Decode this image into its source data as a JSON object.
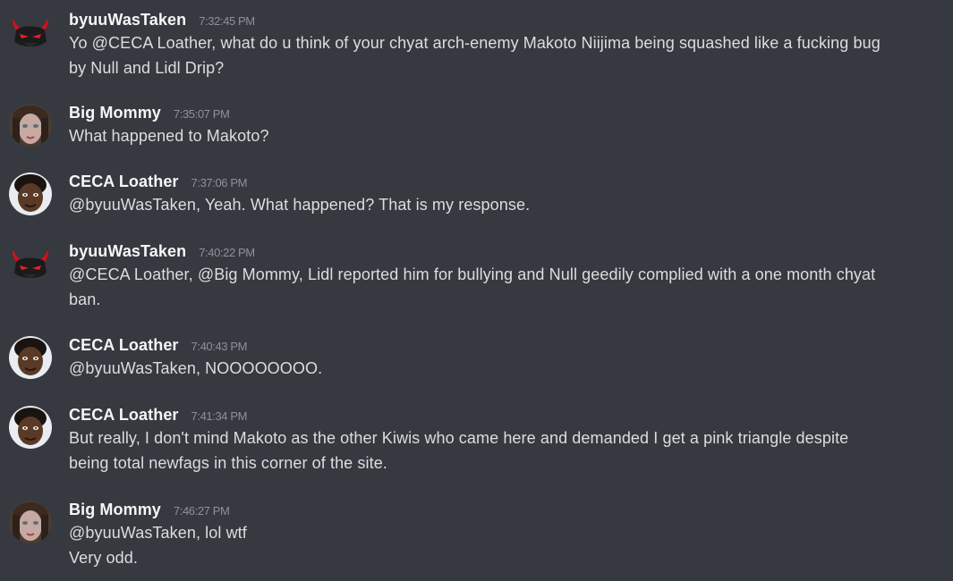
{
  "messages": [
    {
      "author": "byuuWasTaken",
      "timestamp": "7:32:45 PM",
      "lines": [
        "Yo @CECA Loather, what do u think of your chyat arch-enemy Makoto Niijima being squashed like a fucking bug",
        "by Null and Lidl Drip?"
      ],
      "avatar": "devil-avatar"
    },
    {
      "author": "Big Mommy",
      "timestamp": "7:35:07 PM",
      "lines": [
        "What happened to Makoto?"
      ],
      "avatar": "face-avatar-pale"
    },
    {
      "author": "CECA Loather",
      "timestamp": "7:37:06 PM",
      "lines": [
        "@byuuWasTaken, Yeah. What happened? That is my response."
      ],
      "avatar": "face-avatar-dark"
    },
    {
      "author": "byuuWasTaken",
      "timestamp": "7:40:22 PM",
      "lines": [
        "@CECA Loather, @Big Mommy, Lidl reported him for bullying and Null geedily complied with a one month chyat",
        "ban."
      ],
      "avatar": "devil-avatar"
    },
    {
      "author": "CECA Loather",
      "timestamp": "7:40:43 PM",
      "lines": [
        "@byuuWasTaken, NOOOOOOOO."
      ],
      "avatar": "face-avatar-dark"
    },
    {
      "author": "CECA Loather",
      "timestamp": "7:41:34 PM",
      "lines": [
        "But really, I don't mind Makoto as the other Kiwis who came here and demanded I get a pink triangle despite",
        "being total newfags in this corner of the site."
      ],
      "avatar": "face-avatar-dark"
    },
    {
      "author": "Big Mommy",
      "timestamp": "7:46:27 PM",
      "lines": [
        "@byuuWasTaken, lol wtf",
        "Very odd."
      ],
      "avatar": "face-avatar-pale"
    }
  ],
  "colors": {
    "background": "#36393f",
    "author": "#f6f6f7",
    "text": "#dcddde",
    "timestamp": "#8e9297",
    "devil_horns": "#d4101a"
  }
}
